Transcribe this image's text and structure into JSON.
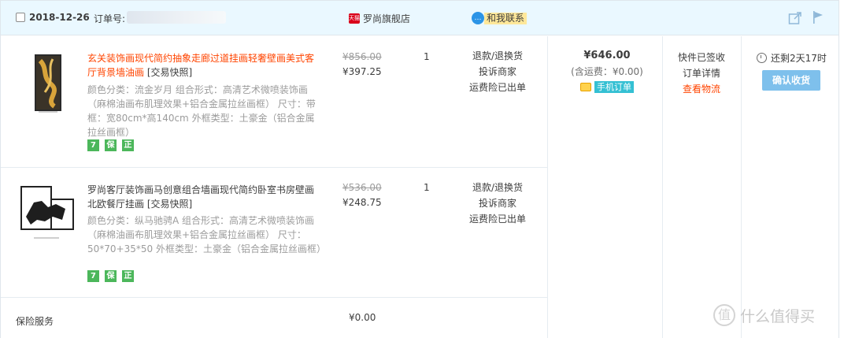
{
  "header": {
    "date": "2018-12-26",
    "order_no_label": "订单号:",
    "shop_name": "罗尚旗舰店",
    "tmall_logo": "天猫",
    "contact_label": "和我联系",
    "contact_icon": "chat-bubble-icon",
    "share_icon": "share-icon",
    "flag_icon": "flag-icon"
  },
  "items": [
    {
      "title": "玄关装饰画现代简约抽象走廊过道挂画轻奢壁画美式客厅背景墙油画",
      "snapshot": "[交易快照]",
      "props": "颜色分类：流金岁月  组合形式：高清艺术微喷装饰画（麻棉油画布肌理效果+铝合金属拉丝画框） 尺寸：带框：宽80cm*高140cm  外框类型：土豪金（铝合金属拉丝画框）",
      "orig_price": "¥856.00",
      "price": "¥397.25",
      "qty": "1",
      "ops": [
        "退款/退换货",
        "投诉商家",
        "运费险已出单"
      ],
      "badges": [
        "7",
        "保",
        "正"
      ]
    },
    {
      "title": "罗尚客厅装饰画马创意组合墙画现代简约卧室书房壁画北欧餐厅挂画",
      "snapshot": "[交易快照]",
      "props": "颜色分类：纵马驰骋A  组合形式：高清艺术微喷装饰画（麻棉油画布肌理效果+铝合金属拉丝画框） 尺寸：50*70+35*50  外框类型：土豪金（铝合金属拉丝画框）",
      "orig_price": "¥536.00",
      "price": "¥248.75",
      "qty": "1",
      "ops": [
        "退款/退换货",
        "投诉商家",
        "运费险已出单"
      ],
      "badges": [
        "7",
        "保",
        "正"
      ]
    }
  ],
  "total": {
    "amount": "¥646.00",
    "shipping": "(含运费：¥0.00)",
    "mobile_tag": "手机订单"
  },
  "status": {
    "line1": "快件已签收",
    "line2": "订单详情",
    "line3": "查看物流"
  },
  "countdown": "还剩2天17时",
  "confirm_button": "确认收货",
  "insurance": {
    "label": "保险服务",
    "price": "¥0.00"
  },
  "watermark": {
    "icon": "值",
    "text": "什么值得买"
  }
}
